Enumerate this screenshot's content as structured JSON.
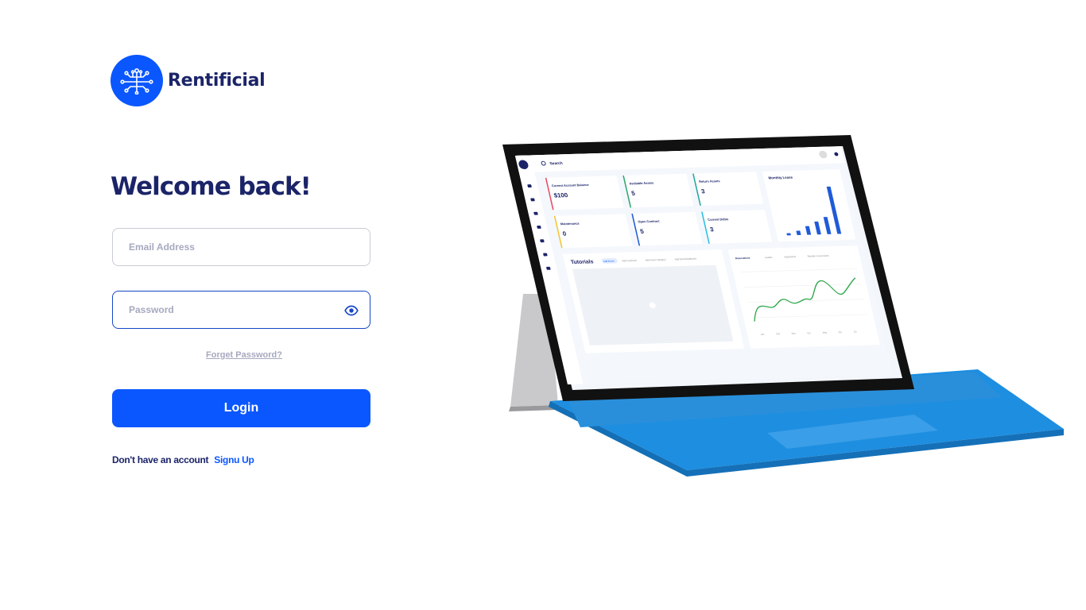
{
  "brand": {
    "name": "Rentificial",
    "logo_icon": "circuit-tree-icon",
    "color": "#0a57ff"
  },
  "form": {
    "title": "Welcome back!",
    "email_placeholder": "Email Address",
    "password_placeholder": "Password",
    "password_icon": "eye-icon",
    "forgot_label": "Forget Password?",
    "login_label": "Login",
    "signup_prompt": "Don't have an account",
    "signup_link": "Signu Up"
  },
  "illustration": {
    "search_placeholder": "Search",
    "cards": [
      {
        "label": "Current Account Balance",
        "value": "$100",
        "accent": "#e84a5f"
      },
      {
        "label": "Available Assets",
        "value": "5",
        "accent": "#2ea66e"
      },
      {
        "label": "Return Assets",
        "value": "3",
        "accent": "#26a69a"
      },
      {
        "label": "Maintenance",
        "value": "0",
        "accent": "#f4c430"
      },
      {
        "label": "Open Contract",
        "value": "5",
        "accent": "#1f5bd8"
      },
      {
        "label": "Current Debts",
        "value": "3",
        "accent": "#28c0e0"
      }
    ],
    "monthly_lease_title": "Monthly Lease",
    "monthly_lease_values": [
      1,
      2,
      4,
      6,
      8,
      22
    ],
    "tutorials_title": "Tutorials",
    "tutorial_tabs": [
      "Add Event",
      "Add Customer",
      "Add Asset Category",
      "Add Rent/Installment"
    ],
    "reservation_tabs": [
      "Reservations",
      "Leases",
      "Inspections",
      "Rentals Conversions"
    ],
    "months": [
      "Jan",
      "Feb",
      "Mar",
      "Apr",
      "May",
      "Jun",
      "Jul"
    ]
  }
}
